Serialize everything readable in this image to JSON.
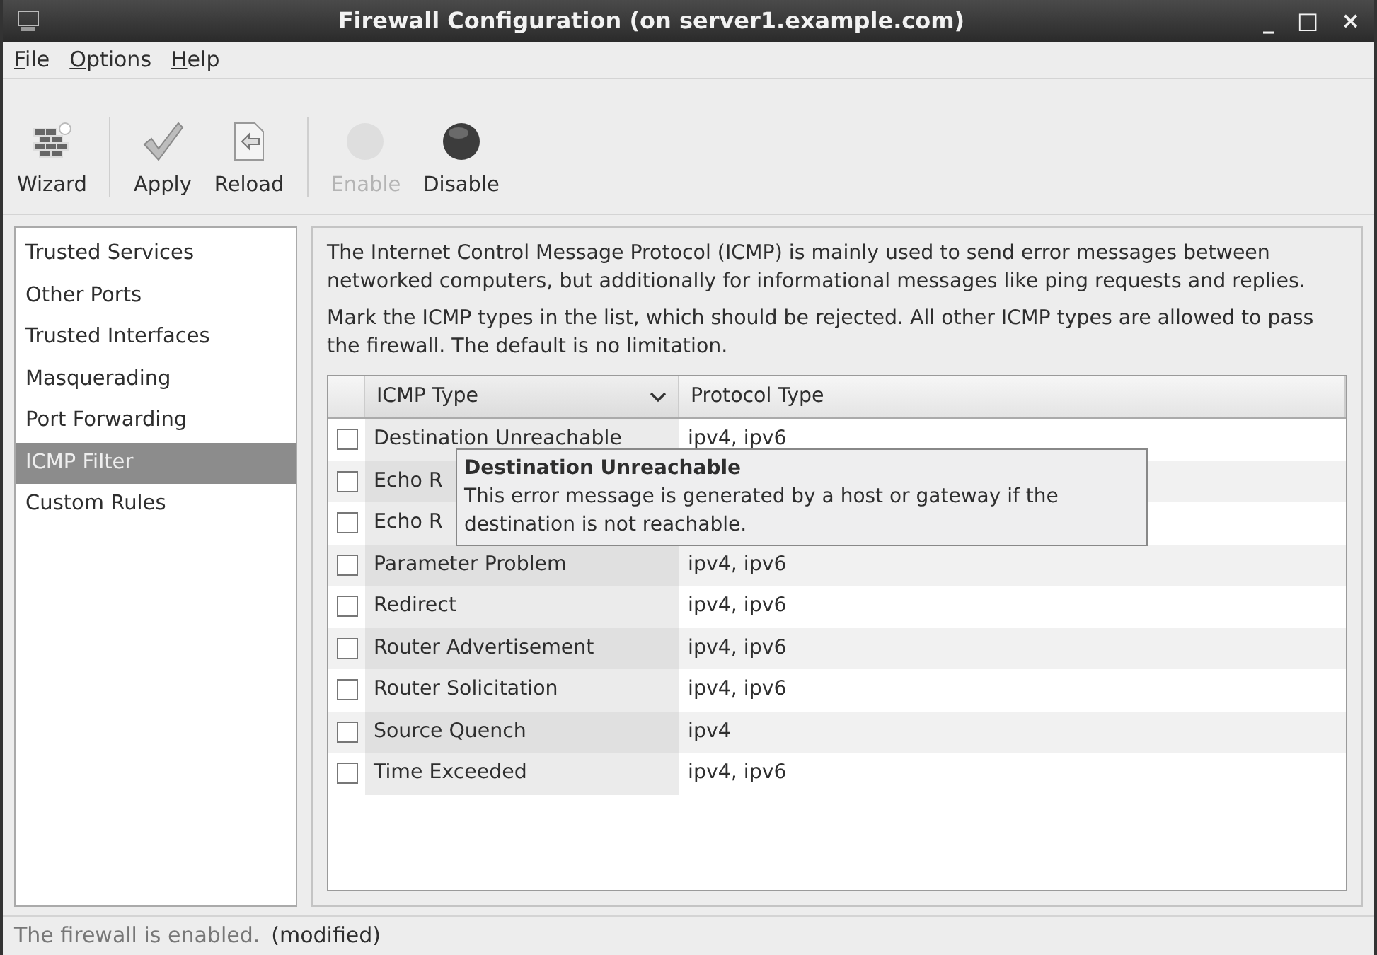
{
  "window": {
    "title": "Firewall Configuration (on server1.example.com)",
    "controls": [
      "_",
      "□",
      "×"
    ]
  },
  "menu": [
    {
      "label": "File"
    },
    {
      "label": "Options"
    },
    {
      "label": "Help"
    }
  ],
  "toolbar": [
    {
      "label": "Wizard",
      "kind": "wizard",
      "disabled": false
    },
    {
      "kind": "separator"
    },
    {
      "label": "Apply",
      "kind": "apply",
      "disabled": false
    },
    {
      "label": "Reload",
      "kind": "reload",
      "disabled": false
    },
    {
      "kind": "separator"
    },
    {
      "label": "Enable",
      "kind": "enable",
      "disabled": true
    },
    {
      "label": "Disable",
      "kind": "disable",
      "disabled": false
    }
  ],
  "sidebar": {
    "items": [
      {
        "label": "Trusted Services",
        "selected": false
      },
      {
        "label": "Other Ports",
        "selected": false
      },
      {
        "label": "Trusted Interfaces",
        "selected": false
      },
      {
        "label": "Masquerading",
        "selected": false
      },
      {
        "label": "Port Forwarding",
        "selected": false
      },
      {
        "label": "ICMP Filter",
        "selected": true
      },
      {
        "label": "Custom Rules",
        "selected": false
      }
    ]
  },
  "description": [
    "The Internet Control Message Protocol (ICMP) is mainly used to send error messages between networked computers, but additionally for informational messages like ping requests and replies.",
    "Mark the ICMP types in the list, which should be rejected. All other ICMP types are allowed to pass the firewall. The default is no limitation."
  ],
  "table": {
    "columns": [
      {
        "label": "ICMP Type",
        "sorted": true
      },
      {
        "label": "Protocol Type",
        "sorted": false
      }
    ],
    "rows": [
      {
        "checked": false,
        "type": "Destination Unreachable",
        "protocol": "ipv4, ipv6"
      },
      {
        "checked": false,
        "type": "Echo R"
      },
      {
        "checked": false,
        "type": "Echo R"
      },
      {
        "checked": false,
        "type": "Parameter Problem",
        "protocol": "ipv4, ipv6"
      },
      {
        "checked": false,
        "type": "Redirect",
        "protocol": "ipv4, ipv6"
      },
      {
        "checked": false,
        "type": "Router Advertisement",
        "protocol": "ipv4, ipv6"
      },
      {
        "checked": false,
        "type": "Router Solicitation",
        "protocol": "ipv4, ipv6"
      },
      {
        "checked": false,
        "type": "Source Quench",
        "protocol": "ipv4"
      },
      {
        "checked": false,
        "type": "Time Exceeded",
        "protocol": "ipv4, ipv6"
      }
    ]
  },
  "tooltip": {
    "title": "Destination Unreachable",
    "text": "This error message is generated by a host or gateway if the destination is not reachable."
  },
  "status_bar": {
    "text": "The firewall is enabled.",
    "note": "(modified)"
  }
}
